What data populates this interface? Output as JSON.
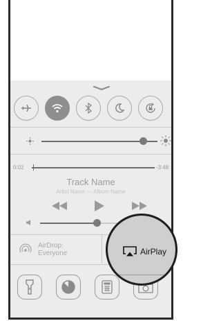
{
  "control_center": {
    "toggles": [
      {
        "name": "airplane-mode",
        "icon": "airplane-icon",
        "on": false
      },
      {
        "name": "wifi",
        "icon": "wifi-icon",
        "on": true
      },
      {
        "name": "bluetooth",
        "icon": "bluetooth-icon",
        "on": false
      },
      {
        "name": "do-not-disturb",
        "icon": "moon-icon",
        "on": false
      },
      {
        "name": "rotation-lock",
        "icon": "rotation-lock-icon",
        "on": false
      }
    ],
    "brightness": {
      "level": 0.88
    },
    "music": {
      "elapsed": "0:02",
      "remaining": "-3:48",
      "progress": 0.01,
      "track_name": "Track Name",
      "artist_album": "Artist Name — Album Name",
      "volume": 0.47
    },
    "airdrop": {
      "line1": "AirDrop:",
      "line2": "Everyone"
    },
    "airplay": {
      "label": "AirPlay"
    },
    "tools": [
      "flashlight-icon",
      "timer-icon",
      "calculator-icon",
      "camera-icon"
    ],
    "colors": {
      "panel": "#ececec",
      "accent": "#8e8e8e",
      "outline": "#1e1e1e"
    }
  }
}
